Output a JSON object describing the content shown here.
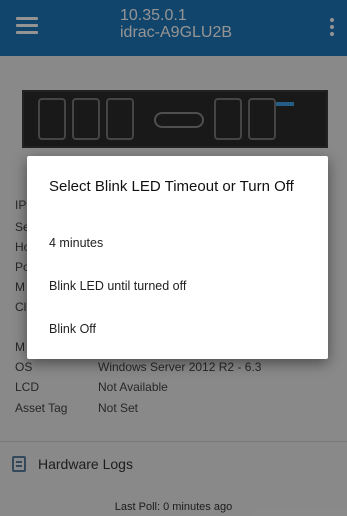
{
  "appbar": {
    "ip": "10.35.0.1",
    "hostname": "idrac-A9GLU2B",
    "menu_icon": "hamburger-menu-icon",
    "overflow_icon": "kebab-menu-icon",
    "background_color": "#1f78b9"
  },
  "server_image": {
    "icon": "server-chassis-image"
  },
  "properties": [
    {
      "label": "IP",
      "value": ""
    },
    {
      "label": "Se",
      "value": ""
    },
    {
      "label": "Ho",
      "value": ""
    },
    {
      "label": "Po",
      "value": ""
    },
    {
      "label": "M",
      "value": ""
    },
    {
      "label": "Cl",
      "value": ""
    },
    {
      "label": "M",
      "value": ""
    },
    {
      "label": "OS",
      "value": "Windows Server 2012 R2 - 6.3"
    },
    {
      "label": "LCD",
      "value": "Not Available"
    },
    {
      "label": "Asset Tag",
      "value": "Not Set"
    }
  ],
  "hardware_logs": {
    "label": "Hardware Logs",
    "icon": "log-document-icon"
  },
  "footer": {
    "last_poll": "Last Poll: 0 minutes ago"
  },
  "dialog": {
    "title": "Select Blink LED Timeout or Turn Off",
    "options": [
      "4 minutes",
      "Blink LED until turned off",
      "Blink Off"
    ]
  }
}
